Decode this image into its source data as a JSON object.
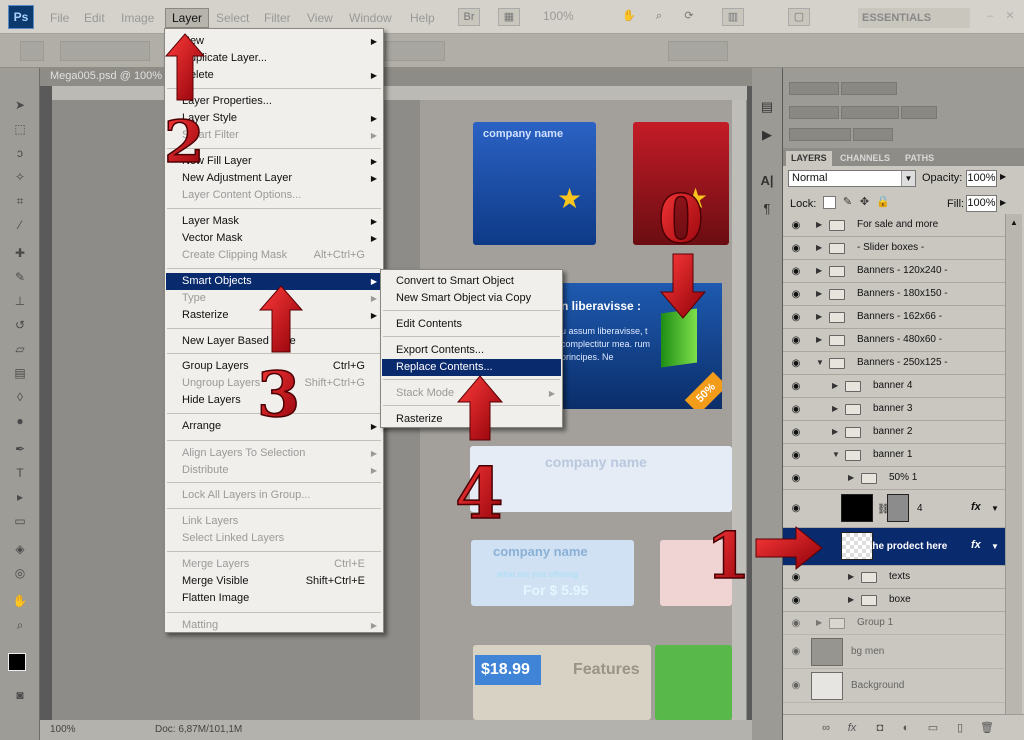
{
  "app": {
    "logo": "Ps"
  },
  "menubar": {
    "items": [
      "File",
      "Edit",
      "Image",
      "Layer",
      "Select",
      "Filter",
      "View",
      "Window",
      "Help"
    ],
    "zoom": "100%",
    "workspace": "ESSENTIALS"
  },
  "document": {
    "tab_label": "Mega005.psd @ 100%",
    "status_zoom": "100%",
    "doc_size": "Doc: 6,87M/101,1M"
  },
  "canvas": {
    "banner_title": "n liberavisse :",
    "banner_text": "u assum liberavisse, t complectitur mea. rum principes. Ne",
    "badge": "50%",
    "blur_labels": [
      "company name",
      "company name",
      "company name",
      "what are you offering",
      "For $ 5.95",
      "$18.99",
      "Features"
    ]
  },
  "layer_menu": {
    "items": [
      {
        "label": "New",
        "arrow": true,
        "disabled": false
      },
      {
        "label": "Duplicate Layer...",
        "disabled": false
      },
      {
        "label": "Delete",
        "arrow": true,
        "disabled": false
      },
      {
        "label": "Layer Properties...",
        "disabled": false
      },
      {
        "label": "Layer Style",
        "arrow": true,
        "disabled": false
      },
      {
        "label": "Smart Filter",
        "arrow": true,
        "disabled": true
      },
      {
        "label": "New Fill Layer",
        "arrow": true,
        "disabled": false
      },
      {
        "label": "New Adjustment Layer",
        "arrow": true,
        "disabled": false
      },
      {
        "label": "Layer Content Options...",
        "disabled": true
      },
      {
        "label": "Layer Mask",
        "arrow": true,
        "disabled": false
      },
      {
        "label": "Vector Mask",
        "arrow": true,
        "disabled": false
      },
      {
        "label": "Create Clipping Mask",
        "shortcut": "Alt+Ctrl+G",
        "disabled": true
      },
      {
        "label": "Smart Objects",
        "arrow": true,
        "highlighted": true
      },
      {
        "label": "Type",
        "arrow": true,
        "disabled": true
      },
      {
        "label": "Rasterize",
        "arrow": true,
        "disabled": false
      },
      {
        "label": "New Layer Based Slice",
        "disabled": false
      },
      {
        "label": "Group Layers",
        "shortcut": "Ctrl+G",
        "disabled": false
      },
      {
        "label": "Ungroup Layers",
        "shortcut": "Shift+Ctrl+G",
        "disabled": true
      },
      {
        "label": "Hide Layers",
        "disabled": false
      },
      {
        "label": "Arrange",
        "arrow": true,
        "disabled": false
      },
      {
        "label": "Align Layers To Selection",
        "arrow": true,
        "disabled": true
      },
      {
        "label": "Distribute",
        "arrow": true,
        "disabled": true
      },
      {
        "label": "Lock All Layers in Group...",
        "disabled": true
      },
      {
        "label": "Link Layers",
        "disabled": true
      },
      {
        "label": "Select Linked Layers",
        "disabled": true
      },
      {
        "label": "Merge Layers",
        "shortcut": "Ctrl+E",
        "disabled": true
      },
      {
        "label": "Merge Visible",
        "shortcut": "Shift+Ctrl+E",
        "disabled": false
      },
      {
        "label": "Flatten Image",
        "disabled": false
      },
      {
        "label": "Matting",
        "arrow": true,
        "disabled": true
      }
    ]
  },
  "smart_menu": {
    "items": [
      {
        "label": "Convert to Smart Object",
        "disabled": false
      },
      {
        "label": "New Smart Object via Copy",
        "disabled": false
      },
      {
        "label": "Edit Contents",
        "disabled": false
      },
      {
        "label": "Export Contents...",
        "disabled": false
      },
      {
        "label": "Replace Contents...",
        "highlighted": true
      },
      {
        "label": "Stack Mode",
        "arrow": true,
        "disabled": true
      },
      {
        "label": "Rasterize",
        "disabled": false
      }
    ]
  },
  "layers_panel": {
    "tabs": [
      "LAYERS",
      "CHANNELS",
      "PATHS"
    ],
    "blend_mode": "Normal",
    "opacity_label": "Opacity:",
    "opacity": "100%",
    "lock_label": "Lock:",
    "fill_label": "Fill:",
    "fill": "100%",
    "layers": [
      {
        "name": "For sale and more",
        "type": "group",
        "indent": 0,
        "expanded": false
      },
      {
        "name": "- Slider boxes -",
        "type": "group",
        "indent": 0,
        "expanded": false
      },
      {
        "name": "Banners - 120x240 -",
        "type": "group",
        "indent": 0,
        "expanded": false
      },
      {
        "name": "Banners - 180x150 -",
        "type": "group",
        "indent": 0,
        "expanded": false
      },
      {
        "name": "Banners - 162x66 -",
        "type": "group",
        "indent": 0,
        "expanded": false
      },
      {
        "name": "Banners - 480x60 -",
        "type": "group",
        "indent": 0,
        "expanded": false
      },
      {
        "name": "Banners - 250x125 -",
        "type": "group",
        "indent": 0,
        "expanded": true
      },
      {
        "name": "banner 4",
        "type": "group",
        "indent": 1,
        "expanded": false
      },
      {
        "name": "banner 3",
        "type": "group",
        "indent": 1,
        "expanded": false
      },
      {
        "name": "banner 2",
        "type": "group",
        "indent": 1,
        "expanded": false
      },
      {
        "name": "banner 1",
        "type": "group",
        "indent": 1,
        "expanded": true
      },
      {
        "name": "50% 1",
        "type": "group",
        "indent": 2,
        "expanded": false
      },
      {
        "name": "4",
        "type": "shape",
        "indent": 2,
        "fx": "fx"
      },
      {
        "name": "the prodect here",
        "type": "smart",
        "indent": 2,
        "fx": "fx",
        "selected": true
      },
      {
        "name": "texts",
        "type": "group",
        "indent": 2,
        "expanded": false
      },
      {
        "name": "boxe",
        "type": "group",
        "indent": 2,
        "expanded": false
      },
      {
        "name": "Group 1",
        "type": "group",
        "indent": 0,
        "expanded": false
      },
      {
        "name": "bg men",
        "type": "layer",
        "indent": 0
      },
      {
        "name": "Background",
        "type": "layer",
        "indent": 0
      }
    ]
  },
  "annotations": {
    "steps": [
      "0",
      "1",
      "2",
      "3",
      "4"
    ],
    "color": "#c8101a"
  }
}
